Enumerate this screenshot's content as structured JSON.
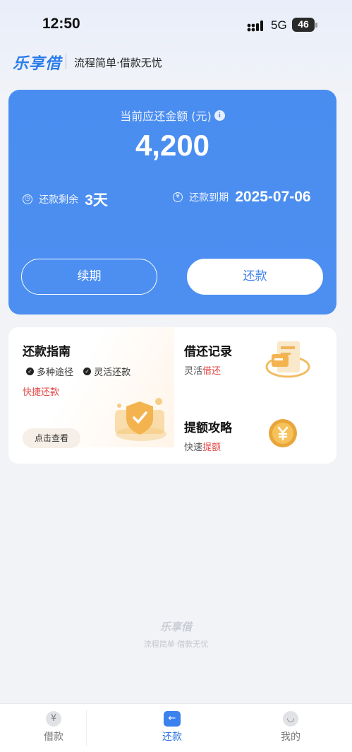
{
  "status_bar": {
    "time": "12:50",
    "network": "5G",
    "battery": "46"
  },
  "header": {
    "logo": "乐享借",
    "tagline": "流程简单·借款无忧"
  },
  "repay_card": {
    "amount_label": "当前应还金额 (元)",
    "amount_value": "4,200",
    "remaining_label": "还款剩余",
    "remaining_value": "3天",
    "due_label": "还款到期",
    "due_value": "2025-07-06",
    "renew_button": "续期",
    "repay_button": "还款"
  },
  "services": {
    "guide": {
      "title": "还款指南",
      "features": [
        "多种途径",
        "灵活还款"
      ],
      "quick": "快捷还款",
      "view_button": "点击查看"
    },
    "record": {
      "title": "借还记录",
      "sub_prefix": "灵活",
      "sub_highlight": "借还"
    },
    "quota": {
      "title": "提额攻略",
      "sub_prefix": "快速",
      "sub_highlight": "提额"
    }
  },
  "watermark": {
    "logo": "乐享借",
    "tagline": "流程简单·借款无忧"
  },
  "tabbar": {
    "items": [
      {
        "label": "借款",
        "icon": "yen-icon",
        "glyph": "¥"
      },
      {
        "label": "还款",
        "icon": "arrow-left-icon",
        "glyph": "←"
      },
      {
        "label": "我的",
        "icon": "profile-icon",
        "glyph": "◡"
      }
    ],
    "active": "还款"
  },
  "colors": {
    "primary": "#4a8df0",
    "accent_red": "#e34a4a",
    "active_tab": "#2b72e0"
  }
}
